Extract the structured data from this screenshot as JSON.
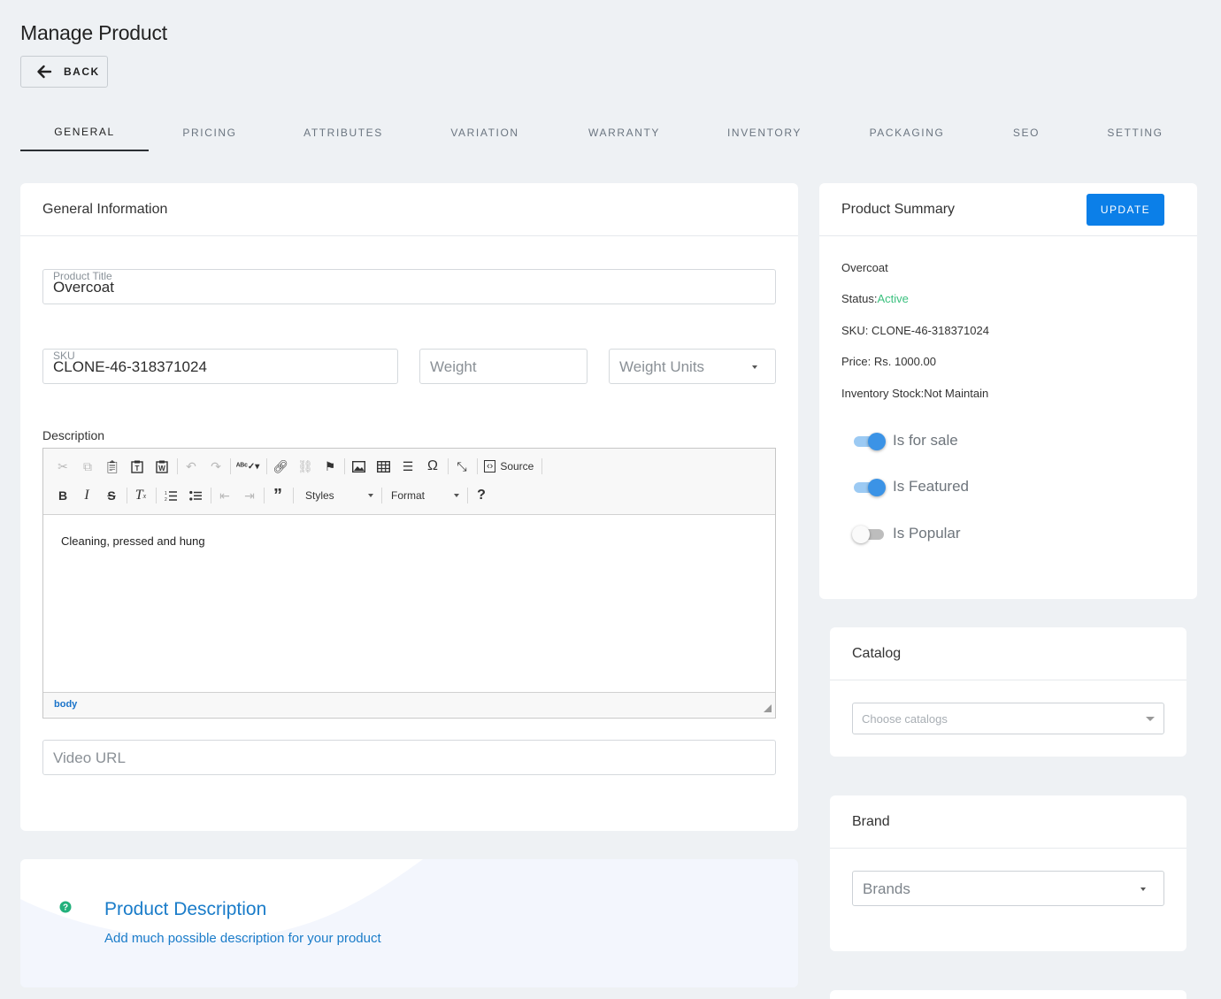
{
  "page": {
    "title": "Manage Product",
    "back_label": "BACK"
  },
  "tabs": [
    "GENERAL",
    "PRICING",
    "ATTRIBUTES",
    "VARIATION",
    "WARRANTY",
    "INVENTORY",
    "PACKAGING",
    "SEO",
    "SETTING"
  ],
  "active_tab": "GENERAL",
  "general": {
    "heading": "General Information",
    "product_title": {
      "label": "Product Title",
      "value": "Overcoat"
    },
    "sku": {
      "label": "SKU",
      "value": "CLONE-46-318371024"
    },
    "weight": {
      "placeholder": "Weight"
    },
    "weight_units": {
      "placeholder": "Weight Units"
    },
    "description_label": "Description",
    "editor": {
      "source_label": "Source",
      "styles_label": "Styles",
      "format_label": "Format",
      "content": "Cleaning, pressed and hung",
      "path": "body"
    },
    "video_url": {
      "placeholder": "Video URL"
    }
  },
  "info": {
    "title": "Product Description",
    "subtitle": "Add much possible description for your product",
    "accent": "#1a7cc9"
  },
  "summary": {
    "heading": "Product Summary",
    "update_label": "UPDATE",
    "name": "Overcoat",
    "status_label": "Status:",
    "status_value": "Active",
    "sku_label": "SKU:",
    "sku_value": "CLONE-46-318371024",
    "price_label": "Price:",
    "price_value": "Rs. 1000.00",
    "stock_label": "Inventory Stock:",
    "stock_value": "Not Maintain",
    "toggles": [
      {
        "label": "Is for sale",
        "on": true
      },
      {
        "label": "Is Featured",
        "on": true
      },
      {
        "label": "Is Popular",
        "on": false
      }
    ]
  },
  "catalog": {
    "heading": "Catalog",
    "placeholder": "Choose catalogs"
  },
  "brand": {
    "heading": "Brand",
    "placeholder": "Brands"
  },
  "colors": {
    "primary": "#0b7fe8",
    "active_status": "#3ac07e",
    "toggle_on": "#3b93e6"
  }
}
